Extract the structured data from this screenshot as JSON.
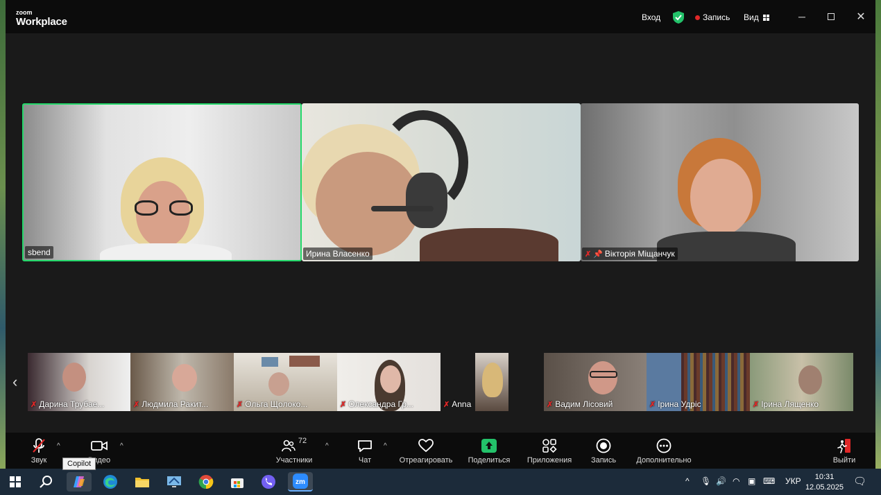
{
  "titlebar": {
    "logo_small": "zoom",
    "logo_big": "Workplace",
    "signin": "Вход",
    "record_status": "Запись",
    "view": "Вид"
  },
  "main_tiles": [
    {
      "name": "sbend",
      "muted": false,
      "active": true
    },
    {
      "name": "Ирина Власенко",
      "muted": false,
      "active": false
    },
    {
      "name": "Віктoрія Міщанчук",
      "muted": true,
      "pinned": true,
      "active": false
    }
  ],
  "strip": [
    {
      "name": "Дарина Трубае...",
      "muted": true
    },
    {
      "name": "Людмила Ракит...",
      "muted": true
    },
    {
      "name": "Ольга Щолоко...",
      "muted": true
    },
    {
      "name": "Олександра Гр...",
      "muted": true
    },
    {
      "name": "Anna",
      "muted": true
    },
    {
      "name": "Вадим Лісовий",
      "muted": true
    },
    {
      "name": "Ірина Удріс",
      "muted": true
    },
    {
      "name": "Ірина Лященко",
      "muted": true
    }
  ],
  "toolbar": {
    "audio": "Звук",
    "video": "Видео",
    "participants": "Участники",
    "participants_count": "72",
    "chat": "Чат",
    "react": "Отреагировать",
    "share": "Поделиться",
    "apps": "Приложения",
    "record": "Запись",
    "more": "Дополнительно",
    "leave": "Выйти"
  },
  "tooltip": "Copilot",
  "taskbar": {
    "lang": "УКР",
    "time": "10:31",
    "date": "12.05.2025"
  },
  "colors": {
    "active_speaker": "#23d96a",
    "muted": "#e02828",
    "share": "#23c26a"
  }
}
